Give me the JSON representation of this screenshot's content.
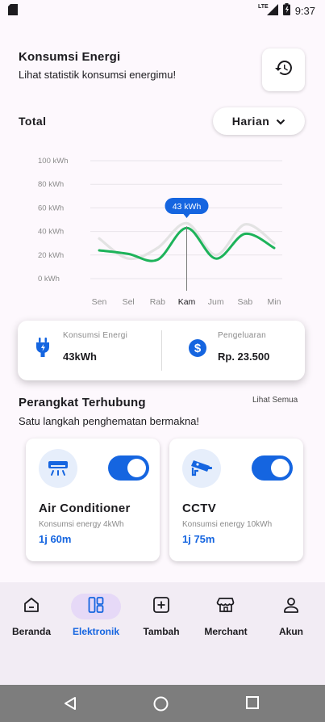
{
  "status_bar": {
    "network_label": "LTE",
    "time": "9:37"
  },
  "header": {
    "title": "Konsumsi Energi",
    "subtitle": "Lihat statistik konsumsi energimu!",
    "history_icon": "history-icon"
  },
  "total": {
    "label": "Total",
    "period": "Harian"
  },
  "chart_data": {
    "type": "line",
    "categories": [
      "Sen",
      "Sel",
      "Rab",
      "Kam",
      "Jum",
      "Sab",
      "Min"
    ],
    "yticks": [
      "100 kWh",
      "80 kWh",
      "60 kWh",
      "40 kWh",
      "20 kWh",
      "0 kWh"
    ],
    "ylim": [
      0,
      100
    ],
    "series": [
      {
        "values": [
          24,
          21,
          16,
          43,
          17,
          38,
          26
        ],
        "color": "#1db35a"
      },
      {
        "values": [
          34,
          17,
          26,
          47,
          20,
          46,
          30
        ],
        "color": "#e3e3e3"
      }
    ],
    "highlight": {
      "category": "Kam",
      "label": "43 kWh",
      "color": "#1565e0"
    },
    "grid": true
  },
  "summary": {
    "energy": {
      "label": "Konsumsi Energi",
      "value": "43kWh",
      "icon": "plug-icon"
    },
    "cost": {
      "label": "Pengeluaran",
      "value": "Rp. 23.500",
      "icon": "dollar-icon"
    }
  },
  "devices_section": {
    "title": "Perangkat Terhubung",
    "see_all": "Lihat Semua",
    "subtitle": "Satu langkah penghematan bermakna!"
  },
  "devices": [
    {
      "name": "Air Conditioner",
      "usage": "Konsumsi energy 4kWh",
      "time": "1j 60m",
      "icon": "air-conditioner-icon",
      "on": true
    },
    {
      "name": "CCTV",
      "usage": "Konsumsi energy 10kWh",
      "time": "1j 75m",
      "icon": "cctv-camera-icon",
      "on": true
    }
  ],
  "nav": [
    {
      "label": "Beranda",
      "icon": "home-icon",
      "active": false
    },
    {
      "label": "Elektronik",
      "icon": "devices-grid-icon",
      "active": true
    },
    {
      "label": "Tambah",
      "icon": "add-box-icon",
      "active": false
    },
    {
      "label": "Merchant",
      "icon": "store-icon",
      "active": false
    },
    {
      "label": "Akun",
      "icon": "person-icon",
      "active": false
    }
  ],
  "colors": {
    "accent": "#1565e0",
    "chart_green": "#1db35a",
    "nav_bg": "#f2ecf4",
    "active_pill": "#e6d9f7"
  }
}
